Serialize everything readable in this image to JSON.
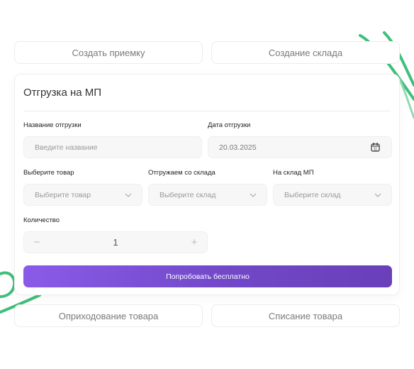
{
  "top_buttons": {
    "create_receipt": "Создать приемку",
    "create_warehouse": "Создание склада"
  },
  "form": {
    "title": "Отгрузка на МП",
    "shipment_name": {
      "label": "Название отгрузки",
      "placeholder": "Введите название"
    },
    "shipment_date": {
      "label": "Дата отгрузки",
      "value": "20.03.2025"
    },
    "product": {
      "label": "Выберите товар",
      "placeholder": "Выберите товар"
    },
    "from_warehouse": {
      "label": "Отгружаем со склада",
      "placeholder": "Выберите склад"
    },
    "to_warehouse": {
      "label": "На склад МП",
      "placeholder": "Выберите склад"
    },
    "quantity": {
      "label": "Количество",
      "value": "1",
      "minus": "−",
      "plus": "+"
    },
    "submit": "Попробовать бесплатно"
  },
  "bottom_buttons": {
    "posting": "Оприходование товара",
    "writeoff": "Списание товара"
  },
  "colors": {
    "accent_start": "#8a5be8",
    "accent_end": "#6a3fba",
    "decor_green": "#3fbf7a"
  },
  "icons": [
    "chevron-down-icon",
    "calendar-icon"
  ]
}
